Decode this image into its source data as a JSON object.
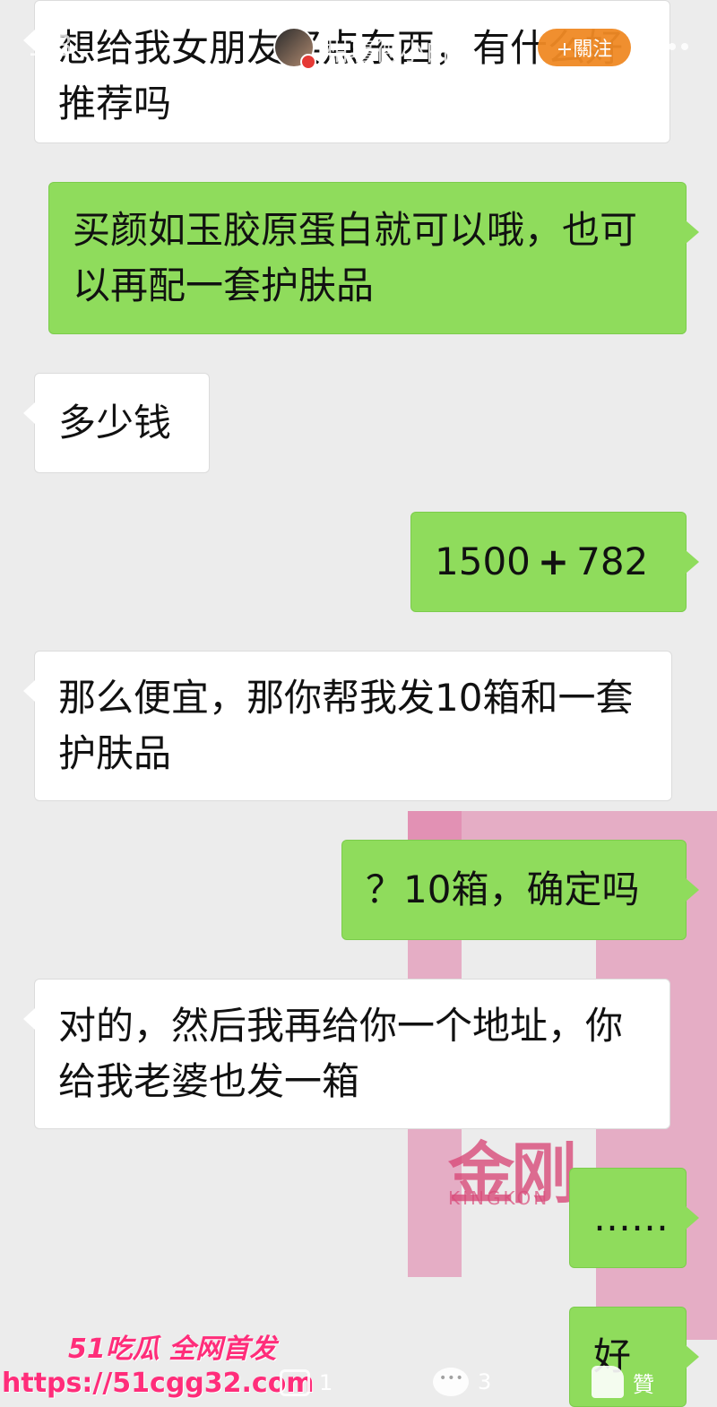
{
  "topbar": {
    "page_counter": "1/3",
    "username": "柑薯德小白",
    "follow_label": "+關注"
  },
  "messages": [
    {
      "side": "left",
      "text": "想给我女朋友买点东西，有什么好推荐吗"
    },
    {
      "side": "right",
      "text": "买颜如玉胶原蛋白就可以哦，也可以再配一套护肤品"
    },
    {
      "side": "left",
      "text": "多少钱"
    },
    {
      "side": "right",
      "text_a": "1500",
      "operator": "+",
      "text_b": "782"
    },
    {
      "side": "left",
      "text": "那么便宜，那你帮我发10箱和一套护肤品"
    },
    {
      "side": "right",
      "text": "？10箱，确定吗"
    },
    {
      "side": "left",
      "text": "对的，然后我再给你一个地址，你给我老婆也发一箱"
    },
    {
      "side": "right",
      "text": "……"
    },
    {
      "side": "right",
      "text": "好"
    }
  ],
  "background": {
    "logo_cn": "金刚",
    "logo_en": "KINGKON"
  },
  "watermark": {
    "title": "51吃瓜 全网首发",
    "url": "https://51cgg32.com"
  },
  "bottombar": {
    "share_count": "1",
    "comment_count": "3",
    "like_label": "贊"
  },
  "colors": {
    "sent_bubble": "#8fdc5c",
    "received_bubble": "#ffffff",
    "follow_button": "#f08a24",
    "watermark": "#ff2d7a"
  }
}
